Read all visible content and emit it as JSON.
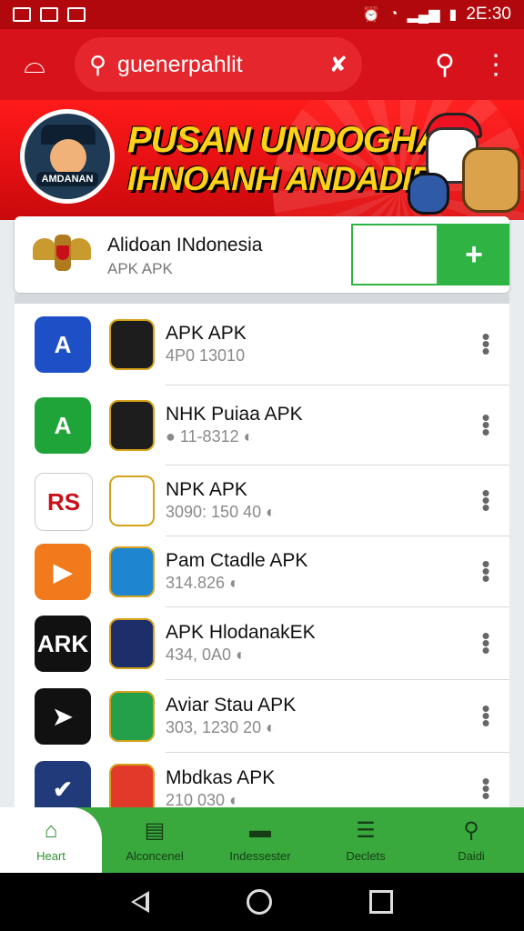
{
  "status_bar": {
    "time": "2E:30"
  },
  "app_bar": {
    "search_query": "guenerpahlit",
    "menu_icon": "basket-icon",
    "search_icon": "search-icon",
    "more_icon": "more-vertical-icon"
  },
  "banner": {
    "badge_text": "AMDANAN",
    "headline_1": "PUSAN UNDOGHAN",
    "headline_2": "IHNOANH ANDADIR!"
  },
  "featured": {
    "title": "Alidoan INdonesia",
    "subtitle": "APK APK",
    "add_label": "+"
  },
  "apps": [
    {
      "name": "APK APK",
      "version": "4P0 13010",
      "icon_color": "#1f4fc6",
      "icon_text": "A",
      "badge_color": "#1d1d1d"
    },
    {
      "name": "NHK Puiaa APK",
      "version": "● 11-8312 ◐",
      "icon_color": "#1fa43a",
      "icon_text": "A",
      "badge_color": "#1d1d1d"
    },
    {
      "name": "NPK APK",
      "version": "3090: 150 40 ◐",
      "icon_color": "#ffffff",
      "icon_text": "RS",
      "badge_color": "#ffffff"
    },
    {
      "name": "Pam Ctadle APK",
      "version": "314.826 ◐",
      "icon_color": "#f07a1c",
      "icon_text": "▶",
      "badge_color": "#1e86d1"
    },
    {
      "name": "APK HlodanakEK",
      "version": "434, 0A0 ◐",
      "icon_color": "#111111",
      "icon_text": "ARK",
      "badge_color": "#1c2f6b"
    },
    {
      "name": "Aviar Stau APK",
      "version": "303, 1230 20 ◐",
      "icon_color": "#111111",
      "icon_text": "➤",
      "badge_color": "#25a04a"
    },
    {
      "name": "Mbdkas APK",
      "version": "210 030 ◐",
      "icon_color": "#203a7a",
      "icon_text": "✔",
      "badge_color": "#e23a2a"
    }
  ],
  "bottom_nav": [
    {
      "label": "Heart",
      "icon": "home-icon"
    },
    {
      "label": "Alconcenel",
      "icon": "document-icon"
    },
    {
      "label": "Indessester",
      "icon": "chat-icon"
    },
    {
      "label": "Declets",
      "icon": "list-icon"
    },
    {
      "label": "Daidi",
      "icon": "search-icon"
    }
  ]
}
